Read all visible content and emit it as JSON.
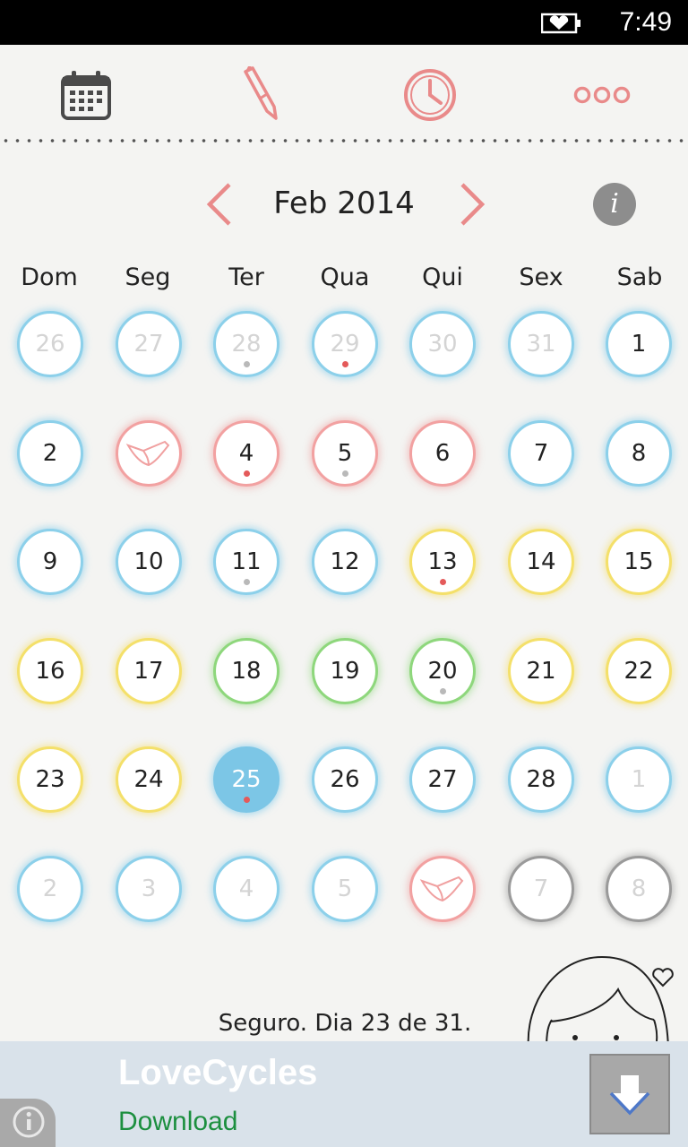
{
  "status_bar": {
    "time": "7:49",
    "battery_icon": "battery-heart-icon"
  },
  "toolbar": {
    "icons": [
      "calendar-icon",
      "pencil-icon",
      "clock-icon",
      "more-icon"
    ],
    "accent_color": "#e98a8a"
  },
  "calendar": {
    "month_label": "Feb 2014",
    "weekdays": [
      "Dom",
      "Seg",
      "Ter",
      "Qua",
      "Qui",
      "Sex",
      "Sab"
    ],
    "weeks": [
      [
        {
          "label": "26",
          "ring": "blue",
          "muted": true,
          "mark": null,
          "icon": null,
          "today": false
        },
        {
          "label": "27",
          "ring": "blue",
          "muted": true,
          "mark": null,
          "icon": null,
          "today": false
        },
        {
          "label": "28",
          "ring": "blue",
          "muted": true,
          "mark": "gray",
          "icon": null,
          "today": false
        },
        {
          "label": "29",
          "ring": "blue",
          "muted": true,
          "mark": "red",
          "icon": null,
          "today": false
        },
        {
          "label": "30",
          "ring": "blue",
          "muted": true,
          "mark": null,
          "icon": null,
          "today": false
        },
        {
          "label": "31",
          "ring": "blue",
          "muted": true,
          "mark": null,
          "icon": null,
          "today": false
        },
        {
          "label": "1",
          "ring": "blue",
          "muted": false,
          "mark": null,
          "icon": null,
          "today": false
        }
      ],
      [
        {
          "label": "2",
          "ring": "blue",
          "muted": false,
          "mark": null,
          "icon": null,
          "today": false
        },
        {
          "label": "",
          "ring": "red",
          "muted": false,
          "mark": null,
          "icon": "underwear-icon",
          "today": false
        },
        {
          "label": "4",
          "ring": "red",
          "muted": false,
          "mark": "red",
          "icon": null,
          "today": false
        },
        {
          "label": "5",
          "ring": "red",
          "muted": false,
          "mark": "gray",
          "icon": null,
          "today": false
        },
        {
          "label": "6",
          "ring": "red",
          "muted": false,
          "mark": null,
          "icon": null,
          "today": false
        },
        {
          "label": "7",
          "ring": "blue",
          "muted": false,
          "mark": null,
          "icon": null,
          "today": false
        },
        {
          "label": "8",
          "ring": "blue",
          "muted": false,
          "mark": null,
          "icon": null,
          "today": false
        }
      ],
      [
        {
          "label": "9",
          "ring": "blue",
          "muted": false,
          "mark": null,
          "icon": null,
          "today": false
        },
        {
          "label": "10",
          "ring": "blue",
          "muted": false,
          "mark": null,
          "icon": null,
          "today": false
        },
        {
          "label": "11",
          "ring": "blue",
          "muted": false,
          "mark": "gray",
          "icon": null,
          "today": false
        },
        {
          "label": "12",
          "ring": "blue",
          "muted": false,
          "mark": null,
          "icon": null,
          "today": false
        },
        {
          "label": "13",
          "ring": "yellow",
          "muted": false,
          "mark": "red",
          "icon": null,
          "today": false
        },
        {
          "label": "14",
          "ring": "yellow",
          "muted": false,
          "mark": null,
          "icon": null,
          "today": false
        },
        {
          "label": "15",
          "ring": "yellow",
          "muted": false,
          "mark": null,
          "icon": null,
          "today": false
        }
      ],
      [
        {
          "label": "16",
          "ring": "yellow",
          "muted": false,
          "mark": null,
          "icon": null,
          "today": false
        },
        {
          "label": "17",
          "ring": "yellow",
          "muted": false,
          "mark": null,
          "icon": null,
          "today": false
        },
        {
          "label": "18",
          "ring": "green",
          "muted": false,
          "mark": null,
          "icon": null,
          "today": false
        },
        {
          "label": "19",
          "ring": "green",
          "muted": false,
          "mark": null,
          "icon": null,
          "today": false
        },
        {
          "label": "20",
          "ring": "green",
          "muted": false,
          "mark": "gray",
          "icon": null,
          "today": false
        },
        {
          "label": "21",
          "ring": "yellow",
          "muted": false,
          "mark": null,
          "icon": null,
          "today": false
        },
        {
          "label": "22",
          "ring": "yellow",
          "muted": false,
          "mark": null,
          "icon": null,
          "today": false
        }
      ],
      [
        {
          "label": "23",
          "ring": "yellow",
          "muted": false,
          "mark": null,
          "icon": null,
          "today": false
        },
        {
          "label": "24",
          "ring": "yellow",
          "muted": false,
          "mark": null,
          "icon": null,
          "today": false
        },
        {
          "label": "25",
          "ring": "blue",
          "muted": false,
          "mark": "red",
          "icon": null,
          "today": true
        },
        {
          "label": "26",
          "ring": "blue",
          "muted": false,
          "mark": null,
          "icon": null,
          "today": false
        },
        {
          "label": "27",
          "ring": "blue",
          "muted": false,
          "mark": null,
          "icon": null,
          "today": false
        },
        {
          "label": "28",
          "ring": "blue",
          "muted": false,
          "mark": null,
          "icon": null,
          "today": false
        },
        {
          "label": "1",
          "ring": "blue",
          "muted": true,
          "mark": null,
          "icon": null,
          "today": false
        }
      ],
      [
        {
          "label": "2",
          "ring": "blue",
          "muted": true,
          "mark": null,
          "icon": null,
          "today": false
        },
        {
          "label": "3",
          "ring": "blue",
          "muted": true,
          "mark": null,
          "icon": null,
          "today": false
        },
        {
          "label": "4",
          "ring": "blue",
          "muted": true,
          "mark": null,
          "icon": null,
          "today": false
        },
        {
          "label": "5",
          "ring": "blue",
          "muted": true,
          "mark": null,
          "icon": null,
          "today": false
        },
        {
          "label": "",
          "ring": "red",
          "muted": true,
          "mark": null,
          "icon": "underwear-icon",
          "today": false
        },
        {
          "label": "7",
          "ring": "gray",
          "muted": true,
          "mark": null,
          "icon": null,
          "today": false
        },
        {
          "label": "8",
          "ring": "gray",
          "muted": true,
          "mark": null,
          "icon": null,
          "today": false
        }
      ]
    ]
  },
  "footer": {
    "message": "Seguro. Dia 23 de 31."
  },
  "ad": {
    "title": "LoveCycles",
    "cta": "Download",
    "info_icon": "info-icon",
    "download_icon": "download-arrow-icon"
  }
}
